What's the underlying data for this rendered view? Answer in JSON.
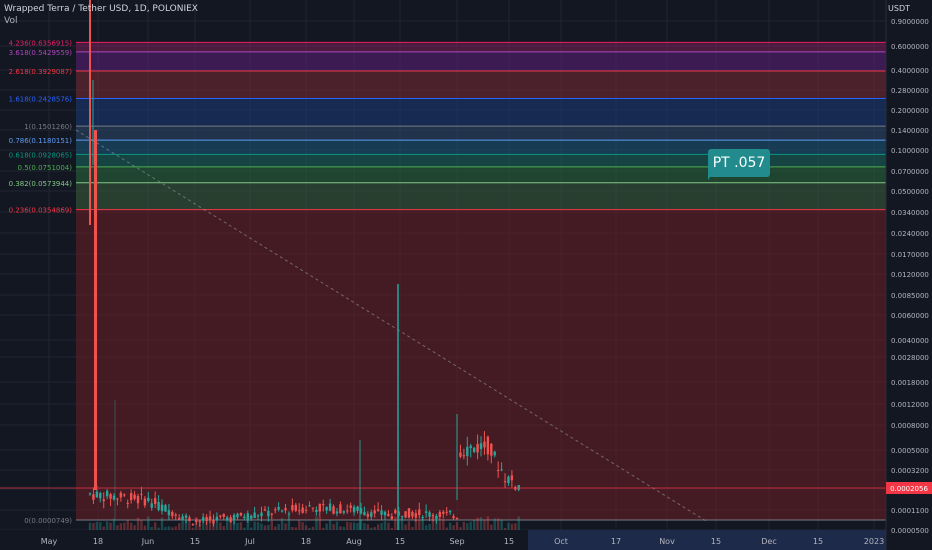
{
  "header": {
    "title": "Wrapped Terra / Tether USD, 1D, POLONIEX",
    "volume_label": "Vol"
  },
  "price_axis": {
    "unit": "USDT",
    "ticks": [
      "0.9000000",
      "0.6000000",
      "0.4000000",
      "0.2800000",
      "0.2000000",
      "0.1400000",
      "0.1000000",
      "0.0700000",
      "0.0500000",
      "0.0340000",
      "0.0240000",
      "0.0170000",
      "0.0120000",
      "0.0085000",
      "0.0060000",
      "0.0040000",
      "0.0028000",
      "0.0018000",
      "0.0012000",
      "0.0008000",
      "0.0005000",
      "0.0003200",
      "0.0002056",
      "0.0001100",
      "0.0000500"
    ],
    "last_price_label": "0.0002056"
  },
  "time_axis": {
    "ticks": [
      "May",
      "18",
      "Jun",
      "15",
      "Jul",
      "18",
      "Aug",
      "15",
      "Sep",
      "15",
      "Oct",
      "17",
      "Nov",
      "15",
      "Dec",
      "15",
      "2023"
    ]
  },
  "fib_levels": [
    {
      "label": "4.236(0.6356915)",
      "color": "#e91e63"
    },
    {
      "label": "3.618(0.5429559)",
      "color": "#ab47bc"
    },
    {
      "label": "2.618(0.3929087)",
      "color": "#f23645"
    },
    {
      "label": "1.618(0.2428576)",
      "color": "#2962ff"
    },
    {
      "label": "1(0.1501260)",
      "color": "#787b86"
    },
    {
      "label": "0.786(0.1180151)",
      "color": "#5b9cf6"
    },
    {
      "label": "0.618(0.0928065)",
      "color": "#089981"
    },
    {
      "label": "0.5(0.0751004)",
      "color": "#4caf50"
    },
    {
      "label": "0.382(0.0573944)",
      "color": "#81c784"
    },
    {
      "label": "0.236(0.0354869)",
      "color": "#f23645"
    },
    {
      "label": "0(0.0000749)",
      "color": "#787b86"
    }
  ],
  "annotation": {
    "text": "PT .057"
  },
  "chart_data": {
    "type": "candlestick",
    "title": "Wrapped Terra / Tether USD, 1D, POLONIEX",
    "y_scale": "log",
    "ylim": [
      5e-05,
      0.9
    ],
    "yunit": "USDT",
    "x_ticks": [
      "May",
      "18",
      "Jun",
      "15",
      "Jul",
      "18",
      "Aug",
      "15",
      "Sep",
      "15",
      "Oct",
      "17",
      "Nov",
      "15",
      "Dec",
      "15",
      "2023"
    ],
    "price_path": [
      [
        "May 15",
        0.2
      ],
      [
        "May 16",
        0.15
      ],
      [
        "May 17",
        0.0002
      ],
      [
        "Jun 1",
        0.00015
      ],
      [
        "Jun 15",
        7e-05
      ],
      [
        "Jul 1",
        9e-05
      ],
      [
        "Jul 18",
        0.00012
      ],
      [
        "Aug 1",
        0.00011
      ],
      [
        "Aug 12",
        9e-05
      ],
      [
        "Aug 15",
        0.0001
      ],
      [
        "Sep 1",
        9e-05
      ],
      [
        "Sep 2",
        0.0005
      ],
      [
        "Sep 10",
        0.00055
      ],
      [
        "Sep 15",
        0.00028
      ],
      [
        "Sep 20",
        0.0002056
      ]
    ],
    "last_price": 0.0002056,
    "fib_retracement": {
      "levels": [
        {
          "ratio": 4.236,
          "price": 0.6356915
        },
        {
          "ratio": 3.618,
          "price": 0.5429559
        },
        {
          "ratio": 2.618,
          "price": 0.3929087
        },
        {
          "ratio": 1.618,
          "price": 0.2428576
        },
        {
          "ratio": 1,
          "price": 0.150126
        },
        {
          "ratio": 0.786,
          "price": 0.1180151
        },
        {
          "ratio": 0.618,
          "price": 0.0928065
        },
        {
          "ratio": 0.5,
          "price": 0.0751004
        },
        {
          "ratio": 0.382,
          "price": 0.0573944
        },
        {
          "ratio": 0.236,
          "price": 0.0354869
        },
        {
          "ratio": 0,
          "price": 7.49e-05
        }
      ]
    },
    "annotations": [
      "PT .057"
    ],
    "grid": true,
    "legend": "none"
  }
}
